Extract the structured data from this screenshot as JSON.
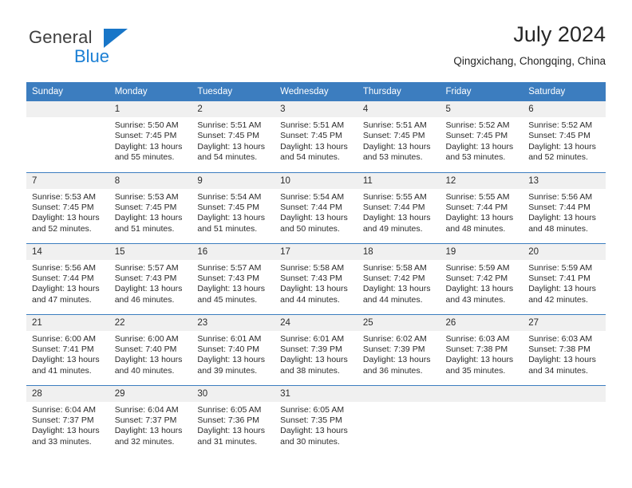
{
  "brand": {
    "name_top": "General",
    "name_bottom": "Blue",
    "triangle_color": "#1876c8",
    "blue_text_color": "#1b7fd4"
  },
  "header": {
    "title": "July 2024",
    "location": "Qingxichang, Chongqing, China"
  },
  "theme": {
    "header_bg": "#3c7dbf",
    "header_text": "#ffffff",
    "daynum_bg": "#f0f0f0",
    "row_divider": "#3c7dbf",
    "body_text": "#2b2b2b"
  },
  "weekdays": [
    "Sunday",
    "Monday",
    "Tuesday",
    "Wednesday",
    "Thursday",
    "Friday",
    "Saturday"
  ],
  "labels": {
    "sunrise_prefix": "Sunrise:",
    "sunset_prefix": "Sunset:",
    "daylight_prefix": "Daylight:"
  },
  "weeks": [
    [
      {
        "day": "",
        "blank": true
      },
      {
        "day": "1",
        "sunrise": "Sunrise: 5:50 AM",
        "sunset": "Sunset: 7:45 PM",
        "daylight1": "Daylight: 13 hours",
        "daylight2": "and 55 minutes."
      },
      {
        "day": "2",
        "sunrise": "Sunrise: 5:51 AM",
        "sunset": "Sunset: 7:45 PM",
        "daylight1": "Daylight: 13 hours",
        "daylight2": "and 54 minutes."
      },
      {
        "day": "3",
        "sunrise": "Sunrise: 5:51 AM",
        "sunset": "Sunset: 7:45 PM",
        "daylight1": "Daylight: 13 hours",
        "daylight2": "and 54 minutes."
      },
      {
        "day": "4",
        "sunrise": "Sunrise: 5:51 AM",
        "sunset": "Sunset: 7:45 PM",
        "daylight1": "Daylight: 13 hours",
        "daylight2": "and 53 minutes."
      },
      {
        "day": "5",
        "sunrise": "Sunrise: 5:52 AM",
        "sunset": "Sunset: 7:45 PM",
        "daylight1": "Daylight: 13 hours",
        "daylight2": "and 53 minutes."
      },
      {
        "day": "6",
        "sunrise": "Sunrise: 5:52 AM",
        "sunset": "Sunset: 7:45 PM",
        "daylight1": "Daylight: 13 hours",
        "daylight2": "and 52 minutes."
      }
    ],
    [
      {
        "day": "7",
        "sunrise": "Sunrise: 5:53 AM",
        "sunset": "Sunset: 7:45 PM",
        "daylight1": "Daylight: 13 hours",
        "daylight2": "and 52 minutes."
      },
      {
        "day": "8",
        "sunrise": "Sunrise: 5:53 AM",
        "sunset": "Sunset: 7:45 PM",
        "daylight1": "Daylight: 13 hours",
        "daylight2": "and 51 minutes."
      },
      {
        "day": "9",
        "sunrise": "Sunrise: 5:54 AM",
        "sunset": "Sunset: 7:45 PM",
        "daylight1": "Daylight: 13 hours",
        "daylight2": "and 51 minutes."
      },
      {
        "day": "10",
        "sunrise": "Sunrise: 5:54 AM",
        "sunset": "Sunset: 7:44 PM",
        "daylight1": "Daylight: 13 hours",
        "daylight2": "and 50 minutes."
      },
      {
        "day": "11",
        "sunrise": "Sunrise: 5:55 AM",
        "sunset": "Sunset: 7:44 PM",
        "daylight1": "Daylight: 13 hours",
        "daylight2": "and 49 minutes."
      },
      {
        "day": "12",
        "sunrise": "Sunrise: 5:55 AM",
        "sunset": "Sunset: 7:44 PM",
        "daylight1": "Daylight: 13 hours",
        "daylight2": "and 48 minutes."
      },
      {
        "day": "13",
        "sunrise": "Sunrise: 5:56 AM",
        "sunset": "Sunset: 7:44 PM",
        "daylight1": "Daylight: 13 hours",
        "daylight2": "and 48 minutes."
      }
    ],
    [
      {
        "day": "14",
        "sunrise": "Sunrise: 5:56 AM",
        "sunset": "Sunset: 7:44 PM",
        "daylight1": "Daylight: 13 hours",
        "daylight2": "and 47 minutes."
      },
      {
        "day": "15",
        "sunrise": "Sunrise: 5:57 AM",
        "sunset": "Sunset: 7:43 PM",
        "daylight1": "Daylight: 13 hours",
        "daylight2": "and 46 minutes."
      },
      {
        "day": "16",
        "sunrise": "Sunrise: 5:57 AM",
        "sunset": "Sunset: 7:43 PM",
        "daylight1": "Daylight: 13 hours",
        "daylight2": "and 45 minutes."
      },
      {
        "day": "17",
        "sunrise": "Sunrise: 5:58 AM",
        "sunset": "Sunset: 7:43 PM",
        "daylight1": "Daylight: 13 hours",
        "daylight2": "and 44 minutes."
      },
      {
        "day": "18",
        "sunrise": "Sunrise: 5:58 AM",
        "sunset": "Sunset: 7:42 PM",
        "daylight1": "Daylight: 13 hours",
        "daylight2": "and 44 minutes."
      },
      {
        "day": "19",
        "sunrise": "Sunrise: 5:59 AM",
        "sunset": "Sunset: 7:42 PM",
        "daylight1": "Daylight: 13 hours",
        "daylight2": "and 43 minutes."
      },
      {
        "day": "20",
        "sunrise": "Sunrise: 5:59 AM",
        "sunset": "Sunset: 7:41 PM",
        "daylight1": "Daylight: 13 hours",
        "daylight2": "and 42 minutes."
      }
    ],
    [
      {
        "day": "21",
        "sunrise": "Sunrise: 6:00 AM",
        "sunset": "Sunset: 7:41 PM",
        "daylight1": "Daylight: 13 hours",
        "daylight2": "and 41 minutes."
      },
      {
        "day": "22",
        "sunrise": "Sunrise: 6:00 AM",
        "sunset": "Sunset: 7:40 PM",
        "daylight1": "Daylight: 13 hours",
        "daylight2": "and 40 minutes."
      },
      {
        "day": "23",
        "sunrise": "Sunrise: 6:01 AM",
        "sunset": "Sunset: 7:40 PM",
        "daylight1": "Daylight: 13 hours",
        "daylight2": "and 39 minutes."
      },
      {
        "day": "24",
        "sunrise": "Sunrise: 6:01 AM",
        "sunset": "Sunset: 7:39 PM",
        "daylight1": "Daylight: 13 hours",
        "daylight2": "and 38 minutes."
      },
      {
        "day": "25",
        "sunrise": "Sunrise: 6:02 AM",
        "sunset": "Sunset: 7:39 PM",
        "daylight1": "Daylight: 13 hours",
        "daylight2": "and 36 minutes."
      },
      {
        "day": "26",
        "sunrise": "Sunrise: 6:03 AM",
        "sunset": "Sunset: 7:38 PM",
        "daylight1": "Daylight: 13 hours",
        "daylight2": "and 35 minutes."
      },
      {
        "day": "27",
        "sunrise": "Sunrise: 6:03 AM",
        "sunset": "Sunset: 7:38 PM",
        "daylight1": "Daylight: 13 hours",
        "daylight2": "and 34 minutes."
      }
    ],
    [
      {
        "day": "28",
        "sunrise": "Sunrise: 6:04 AM",
        "sunset": "Sunset: 7:37 PM",
        "daylight1": "Daylight: 13 hours",
        "daylight2": "and 33 minutes."
      },
      {
        "day": "29",
        "sunrise": "Sunrise: 6:04 AM",
        "sunset": "Sunset: 7:37 PM",
        "daylight1": "Daylight: 13 hours",
        "daylight2": "and 32 minutes."
      },
      {
        "day": "30",
        "sunrise": "Sunrise: 6:05 AM",
        "sunset": "Sunset: 7:36 PM",
        "daylight1": "Daylight: 13 hours",
        "daylight2": "and 31 minutes."
      },
      {
        "day": "31",
        "sunrise": "Sunrise: 6:05 AM",
        "sunset": "Sunset: 7:35 PM",
        "daylight1": "Daylight: 13 hours",
        "daylight2": "and 30 minutes."
      },
      {
        "day": "",
        "blank": true
      },
      {
        "day": "",
        "blank": true
      },
      {
        "day": "",
        "blank": true
      }
    ]
  ]
}
